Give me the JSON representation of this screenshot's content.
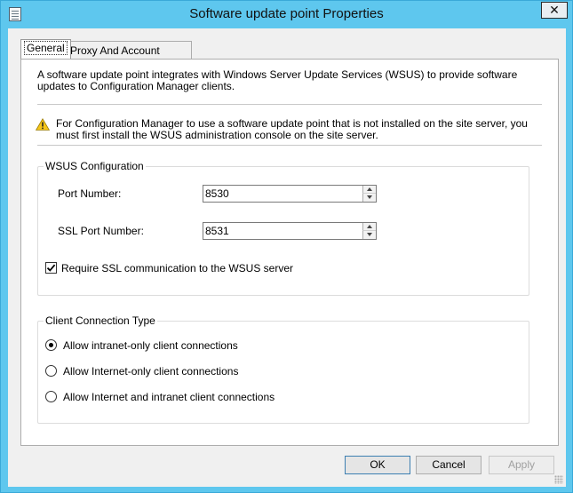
{
  "window": {
    "title": "Software update point Properties",
    "close_glyph": "✕"
  },
  "tabs": [
    {
      "label": "General",
      "active": true
    },
    {
      "label": "Proxy And Account Settings",
      "active": false
    }
  ],
  "general": {
    "intro": "A software update point integrates with Windows Server Update Services (WSUS) to provide software updates to Configuration Manager clients.",
    "warning": "For Configuration Manager to use a software update point that is not installed on the site server, you must first install the WSUS administration console on the site server.",
    "wsus": {
      "group_label": "WSUS Configuration",
      "port_label": "Port Number:",
      "port_value": "8530",
      "ssl_port_label": "SSL Port Number:",
      "ssl_port_value": "8531",
      "require_ssl_label": "Require SSL communication to the WSUS server",
      "require_ssl_checked": true
    },
    "client_connection": {
      "group_label": "Client Connection Type",
      "options": [
        {
          "label": "Allow intranet-only client connections",
          "selected": true
        },
        {
          "label": "Allow Internet-only client connections",
          "selected": false
        },
        {
          "label": "Allow Internet and intranet client connections",
          "selected": false
        }
      ]
    }
  },
  "buttons": {
    "ok": "OK",
    "cancel": "Cancel",
    "apply": "Apply"
  },
  "icons": {
    "app": "properties-sheet-icon",
    "warning": "warning-triangle-icon"
  },
  "colors": {
    "titlebar": "#5ec7ee",
    "warning": "#f5c518",
    "default_button_border": "#3c7fb1"
  }
}
